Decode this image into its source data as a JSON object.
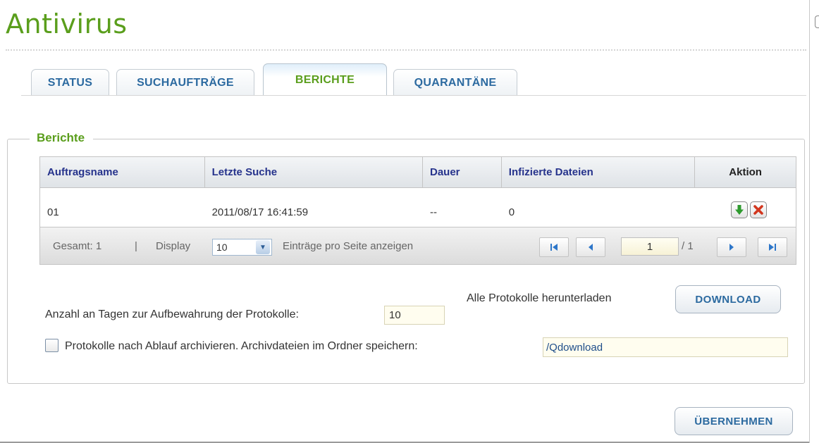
{
  "page": {
    "title": "Antivirus"
  },
  "tabs": [
    {
      "label": "STATUS",
      "active": false
    },
    {
      "label": "SUCHAUFTRÄGE",
      "active": false
    },
    {
      "label": "BERICHTE",
      "active": true
    },
    {
      "label": "QUARANTÄNE",
      "active": false
    }
  ],
  "section": {
    "legend": "Berichte"
  },
  "table": {
    "columns": [
      "Auftragsname",
      "Letzte Suche",
      "Dauer",
      "Infizierte Dateien",
      "Aktion"
    ],
    "rows": [
      {
        "name": "01",
        "last_scan": "2011/08/17 16:41:59",
        "duration": "--",
        "infected": "0"
      }
    ],
    "action_icons": [
      "download-icon",
      "delete-icon"
    ]
  },
  "pager": {
    "total_label": "Gesamt: 1",
    "separator": "|",
    "display_label": "Display",
    "per_page": "10",
    "per_page_suffix": "Einträge pro Seite anzeigen",
    "current_page": "1",
    "total_pages": "/ 1"
  },
  "logs": {
    "download_label": "Alle Protokolle herunterladen",
    "download_button": "DOWNLOAD",
    "retention_label": "Anzahl an Tagen zur Aufbewahrung der Protokolle:",
    "retention_days": "10",
    "archive_label": "Protokolle nach Ablauf archivieren. Archivdateien im Ordner speichern:",
    "archive_checked": false,
    "archive_folder": "/Qdownload"
  },
  "footer": {
    "apply_button": "ÜBERNEHMEN"
  },
  "colors": {
    "accent_green": "#5a9e1c",
    "tab_blue": "#2c6aa0",
    "header_navy": "#26338c"
  }
}
